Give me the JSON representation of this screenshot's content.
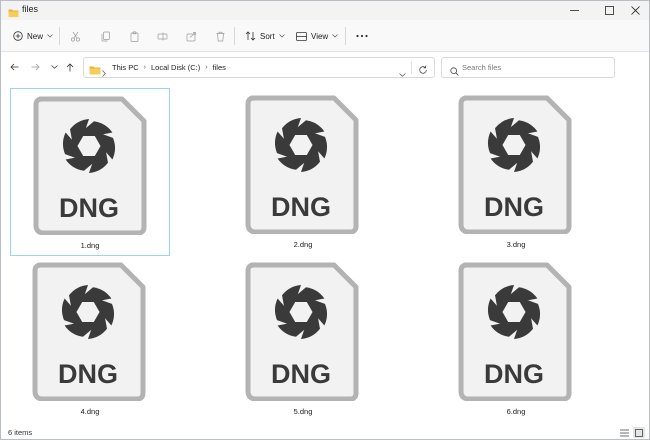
{
  "window": {
    "title": "files",
    "controls": [
      "minimize",
      "maximize",
      "close"
    ]
  },
  "toolbar": {
    "new_label": "New",
    "sort_label": "Sort",
    "view_label": "View",
    "icons": [
      "cut-icon",
      "copy-icon",
      "paste-icon",
      "rename-icon",
      "share-icon",
      "delete-icon",
      "more-icon"
    ]
  },
  "address": {
    "breadcrumb": [
      "This PC",
      "Local Disk (C:)",
      "files"
    ]
  },
  "search": {
    "placeholder": "Search files",
    "value": ""
  },
  "files": [
    {
      "name": "1.dng",
      "icon_text": "DNG",
      "selected": true
    },
    {
      "name": "2.dng",
      "icon_text": "DNG",
      "selected": false
    },
    {
      "name": "3.dng",
      "icon_text": "DNG",
      "selected": false
    },
    {
      "name": "4.dng",
      "icon_text": "DNG",
      "selected": false
    },
    {
      "name": "5.dng",
      "icon_text": "DNG",
      "selected": false
    },
    {
      "name": "6.dng",
      "icon_text": "DNG",
      "selected": false
    }
  ],
  "status": {
    "item_count": "6 items"
  },
  "colors": {
    "icon_border": "#b3b3b3",
    "icon_fill": "#f2f2f2",
    "icon_glyph": "#3a3a3a",
    "folder": "#f2c14e",
    "selection_border": "#99d1ff"
  }
}
